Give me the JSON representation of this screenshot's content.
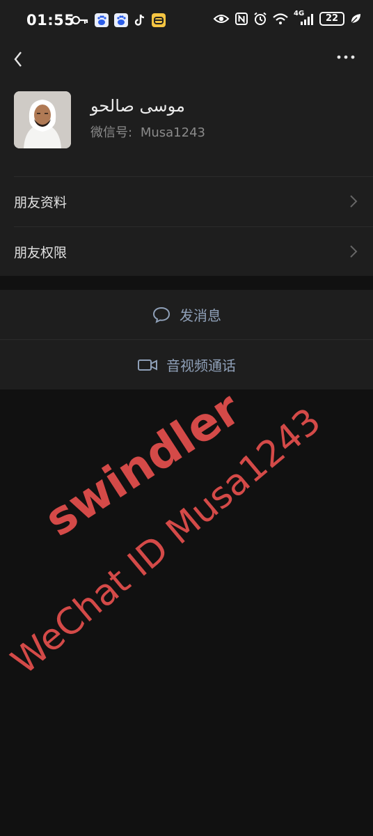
{
  "status_bar": {
    "time": "01:55",
    "battery_level": "22",
    "network_label": "4G",
    "icons_left": [
      "key-icon",
      "baidu-icon",
      "baidu-icon",
      "tiktok-icon",
      "app-icon"
    ],
    "icons_right": [
      "eye-icon",
      "nfc-icon",
      "alarm-icon",
      "wifi-icon",
      "signal-icon",
      "battery-icon",
      "leaf-icon"
    ]
  },
  "header": {
    "back_icon": "chevron-left-icon",
    "more_icon": "more-dots-icon"
  },
  "profile": {
    "name": "موسى صالحو",
    "wechat_id_label": "微信号:",
    "wechat_id_value": "Musa1243"
  },
  "list": [
    {
      "label": "朋友资料"
    },
    {
      "label": "朋友权限"
    }
  ],
  "actions": {
    "message_label": "发消息",
    "video_call_label": "音视频通话"
  },
  "overlay": {
    "swindler": "swindler",
    "wechat_id": "WeChat ID Musa1243",
    "color": "#d44a48"
  }
}
